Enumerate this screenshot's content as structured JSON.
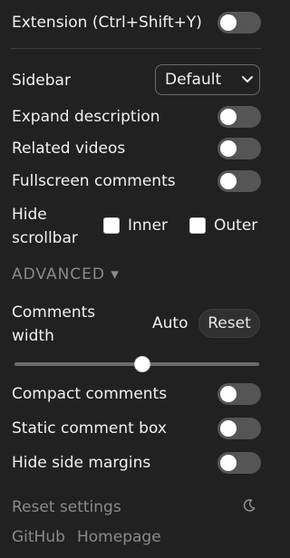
{
  "extension": {
    "label": "Extension (Ctrl+Shift+Y)",
    "enabled": false
  },
  "sidebar": {
    "label": "Sidebar",
    "selected": "Default"
  },
  "toggles": {
    "expand_description": {
      "label": "Expand description",
      "enabled": false
    },
    "related_videos": {
      "label": "Related videos",
      "enabled": false
    },
    "fullscreen_comments": {
      "label": "Fullscreen comments",
      "enabled": false
    }
  },
  "hide_scrollbar": {
    "label_line1": "Hide",
    "label_line2": "scrollbar",
    "inner_label": "Inner",
    "outer_label": "Outer",
    "inner_checked": false,
    "outer_checked": false
  },
  "advanced": {
    "label": "ADVANCED ▾"
  },
  "comments_width": {
    "label_line1": "Comments",
    "label_line2": "width",
    "value": "Auto",
    "reset_label": "Reset",
    "slider_level": 0.52
  },
  "advanced_toggles": {
    "compact_comments": {
      "label": "Compact comments",
      "enabled": false
    },
    "static_comment_box": {
      "label": "Static comment box",
      "enabled": false
    },
    "hide_side_margins": {
      "label": "Hide side margins",
      "enabled": false
    }
  },
  "footer": {
    "reset_settings": "Reset settings",
    "github": "GitHub",
    "homepage": "Homepage",
    "theme_icon": "moon-icon"
  },
  "colors": {
    "background": "#212121",
    "text": "#f1f1f1",
    "muted": "#8a8a8a",
    "toggle_off": "#555555"
  }
}
